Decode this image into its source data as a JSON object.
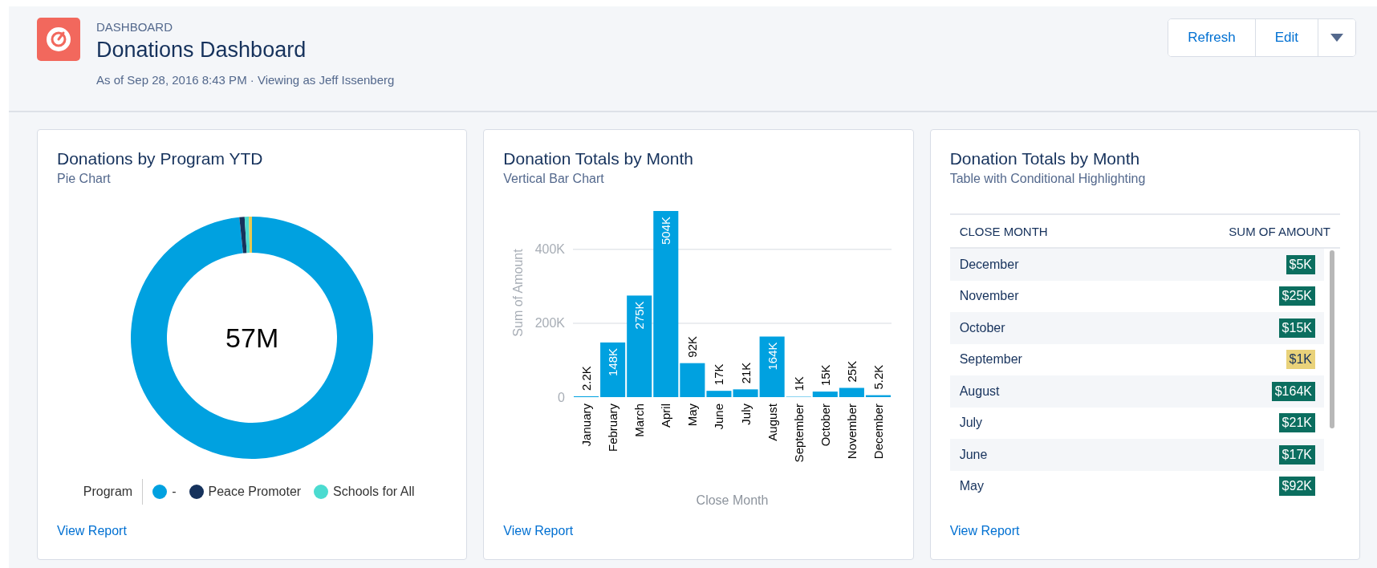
{
  "header": {
    "label": "DASHBOARD",
    "title": "Donations Dashboard",
    "subtitle": "As of Sep 28, 2016 8:43 PM · Viewing as Jeff Issenberg",
    "buttons": [
      "Refresh",
      "Edit"
    ]
  },
  "cards": [
    {
      "kind": "donut",
      "title": "Donations by Program YTD",
      "subtitle": "Pie Chart",
      "total": "57M",
      "legend_title": "Program",
      "legend": [
        {
          "label": "-",
          "color": "#00a1e0"
        },
        {
          "label": "Peace Promoter",
          "color": "#16325c"
        },
        {
          "label": "Schools for All",
          "color": "#4bdbd0"
        }
      ],
      "link": "View Report"
    },
    {
      "kind": "bar",
      "title": "Donation Totals by Month",
      "subtitle": "Vertical Bar Chart",
      "chart_data": {
        "type": "bar",
        "xlabel": "Close Month",
        "ylabel": "Sum of Amount",
        "categories": [
          "January",
          "February",
          "March",
          "April",
          "May",
          "June",
          "July",
          "August",
          "September",
          "October",
          "November",
          "December"
        ],
        "values": [
          2200,
          148000,
          275000,
          504000,
          92000,
          17000,
          21000,
          164000,
          1000,
          15000,
          25000,
          5200
        ],
        "value_labels": [
          "2.2K",
          "148K",
          "275K",
          "504K",
          "92K",
          "17K",
          "21K",
          "164K",
          "1K",
          "15K",
          "25K",
          "5.2K"
        ],
        "ylim": [
          0,
          504000
        ],
        "yticks": [
          {
            "value": 0,
            "label": "0"
          },
          {
            "value": 200000,
            "label": "200K"
          },
          {
            "value": 400000,
            "label": "400K"
          }
        ],
        "data_labels": true
      },
      "link": "View Report"
    },
    {
      "kind": "table",
      "title": "Donation Totals by Month",
      "subtitle": "Table with Conditional Highlighting",
      "columns": [
        "CLOSE MONTH",
        "SUM OF AMOUNT"
      ],
      "rows": [
        {
          "month": "December",
          "amount": "$5K",
          "color": "#0b6e5f"
        },
        {
          "month": "November",
          "amount": "$25K",
          "color": "#0b6e5f"
        },
        {
          "month": "October",
          "amount": "$15K",
          "color": "#0b6e5f"
        },
        {
          "month": "September",
          "amount": "$1K",
          "color": "#e9d27a"
        },
        {
          "month": "August",
          "amount": "$164K",
          "color": "#0b6e5f"
        },
        {
          "month": "July",
          "amount": "$21K",
          "color": "#0b6e5f"
        },
        {
          "month": "June",
          "amount": "$17K",
          "color": "#0b6e5f"
        },
        {
          "month": "May",
          "amount": "$92K",
          "color": "#0b6e5f"
        }
      ],
      "link": "View Report"
    }
  ]
}
